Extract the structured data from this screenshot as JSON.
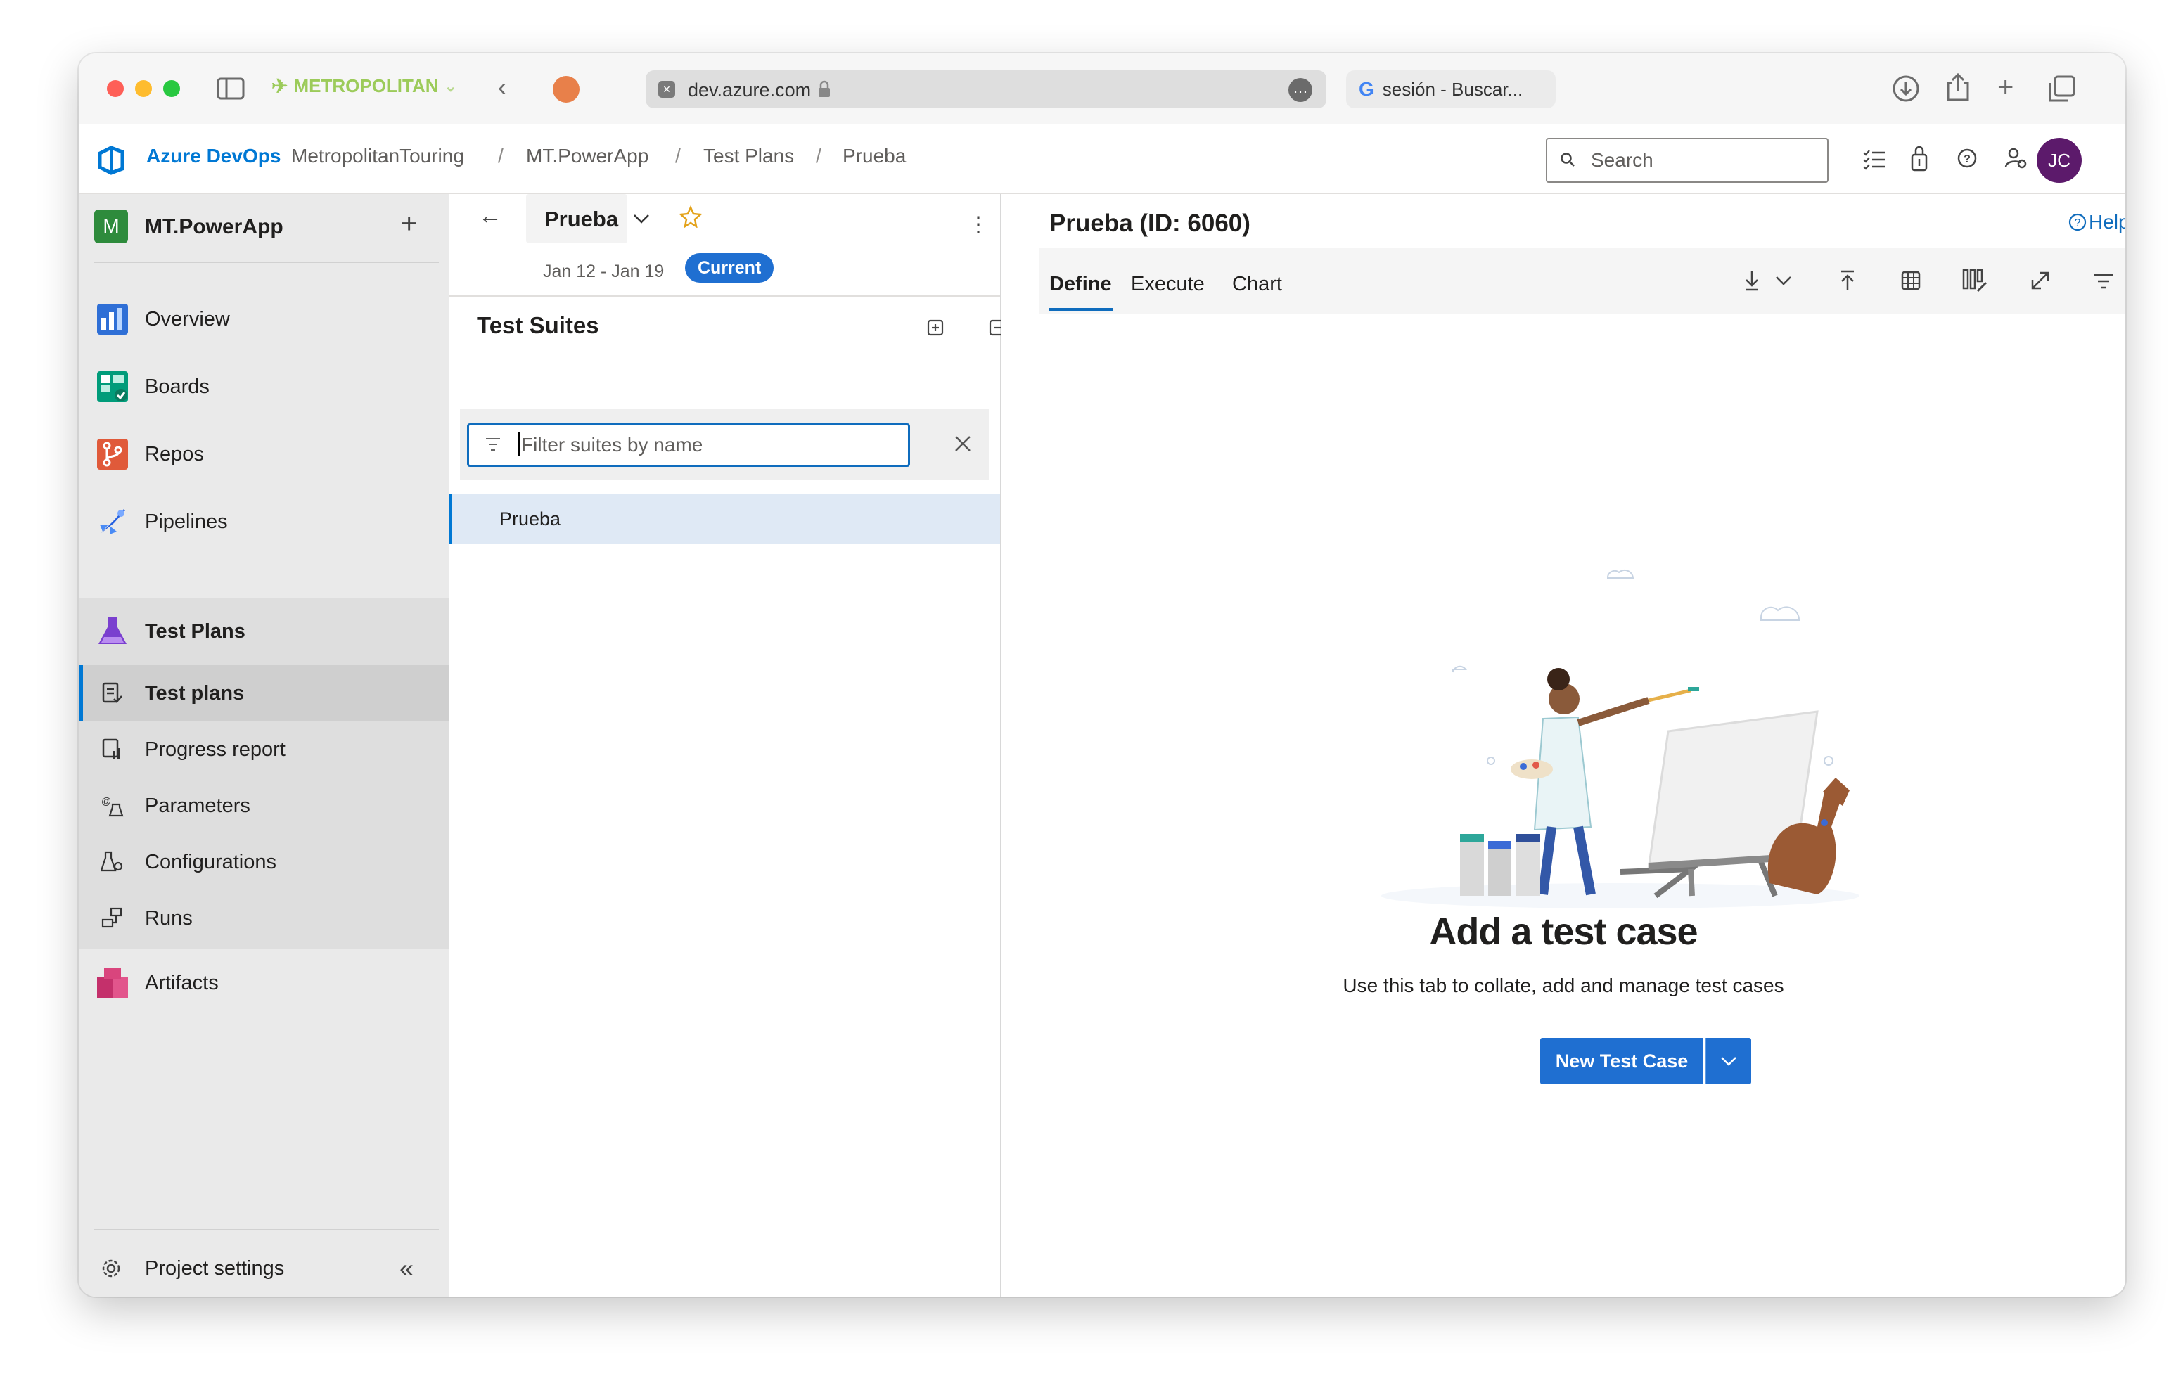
{
  "browser": {
    "profile": "METROPOLITAN",
    "url": "dev.azure.com",
    "other_tab": "sesión - Buscar..."
  },
  "header": {
    "brand": "Azure DevOps",
    "breadcrumb": [
      "MetropolitanTouring",
      "MT.PowerApp",
      "Test Plans",
      "Prueba"
    ],
    "separator": "/",
    "search_placeholder": "Search",
    "avatar_initials": "JC"
  },
  "sidebar": {
    "project_initial": "M",
    "project_name": "MT.PowerApp",
    "add_symbol": "+",
    "items": [
      {
        "label": "Overview",
        "icon": "overview-icon"
      },
      {
        "label": "Boards",
        "icon": "boards-icon"
      },
      {
        "label": "Repos",
        "icon": "repos-icon"
      },
      {
        "label": "Pipelines",
        "icon": "pipelines-icon"
      },
      {
        "label": "Test Plans",
        "icon": "test-plans-icon"
      }
    ],
    "sub_items": [
      {
        "label": "Test plans",
        "icon": "test-plans-list-icon"
      },
      {
        "label": "Progress report",
        "icon": "progress-report-icon"
      },
      {
        "label": "Parameters",
        "icon": "parameters-icon"
      },
      {
        "label": "Configurations",
        "icon": "configurations-icon"
      },
      {
        "label": "Runs",
        "icon": "runs-icon"
      }
    ],
    "artifacts": "Artifacts",
    "project_settings": "Project settings",
    "colors": {
      "active_bar": "#0078d4",
      "nav_bg": "#eaeaea"
    }
  },
  "plan": {
    "name": "Prueba",
    "dates": "Jan 12 - Jan 19",
    "badge": "Current",
    "suites_title": "Test Suites",
    "filter_placeholder": "Filter suites by name",
    "suites": [
      "Prueba"
    ]
  },
  "detail": {
    "title": "Prueba (ID: 6060)",
    "help": "Help",
    "tabs": [
      "Define",
      "Execute",
      "Chart"
    ],
    "active_tab": "Define",
    "empty_title": "Add a test case",
    "empty_subtitle": "Use this tab to collate, add and manage test cases",
    "new_button": "New Test Case",
    "accent": "#0f6cbd"
  }
}
